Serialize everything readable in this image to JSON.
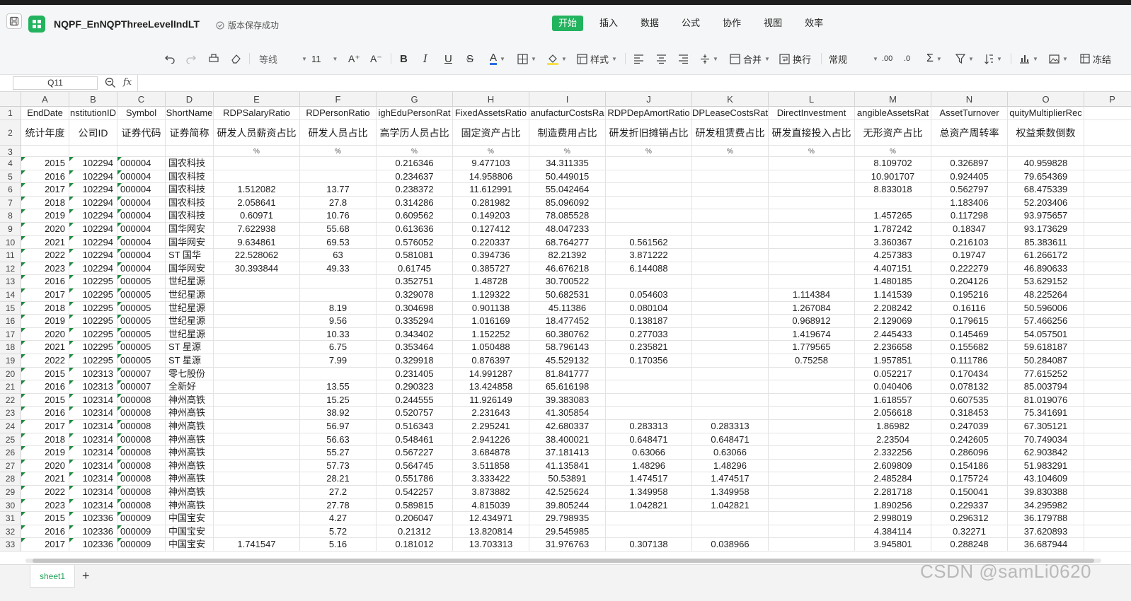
{
  "title_bar": {
    "doc_title": "NQPF_EnNQPThreeLevelIndLT",
    "save_status": "版本保存成功",
    "menu": [
      "开始",
      "插入",
      "数据",
      "公式",
      "协作",
      "视图",
      "效率"
    ],
    "active_menu": "开始",
    "accent_color": "#22b35e"
  },
  "toolbar": {
    "font_name": "等线",
    "font_size": "11",
    "style_label": "样式",
    "merge_label": "合并",
    "wrap_label": "换行",
    "number_format": "常规",
    "freeze_label": "冻结"
  },
  "formula_bar": {
    "cell_ref": "Q11",
    "fx": "fx",
    "value": ""
  },
  "sheet": {
    "col_letters": [
      "A",
      "B",
      "C",
      "D",
      "E",
      "F",
      "G",
      "H",
      "I",
      "J",
      "K",
      "L",
      "M",
      "N",
      "O",
      "P"
    ],
    "header_en": [
      "EndDate",
      "nstitutionID",
      "Symbol",
      "ShortName",
      "RDPSalaryRatio",
      "RDPersonRatio",
      "ighEduPersonRat",
      "FixedAssetsRatio",
      "anufacturCostsRa",
      "RDPDepAmortRatio",
      "DPLeaseCostsRat",
      "DirectInvestment",
      "angibleAssetsRat",
      "AssetTurnover",
      "quityMultiplierRec"
    ],
    "header_cn": [
      "统计年度",
      "公司ID",
      "证券代码",
      "证券简称",
      "研发人员薪资占比",
      "研发人员占比",
      "高学历人员占比",
      "固定资产占比",
      "制造费用占比",
      "研发折旧摊销占比",
      "研发租赁费占比",
      "研发直接投入占比",
      "无形资产占比",
      "总资产周转率",
      "权益乘数倒数"
    ],
    "units": [
      "",
      "",
      "",
      "",
      "%",
      "%",
      "%",
      "%",
      "%",
      "%",
      "%",
      "%",
      "%",
      "",
      ""
    ],
    "rows": [
      [
        "2015",
        "102294",
        "000004",
        "国农科技",
        "",
        "",
        "0.216346",
        "9.477103",
        "34.311335",
        "",
        "",
        "",
        "8.109702",
        "0.326897",
        "40.959828"
      ],
      [
        "2016",
        "102294",
        "000004",
        "国农科技",
        "",
        "",
        "0.234637",
        "14.958806",
        "50.449015",
        "",
        "",
        "",
        "10.901707",
        "0.924405",
        "79.654369"
      ],
      [
        "2017",
        "102294",
        "000004",
        "国农科技",
        "1.512082",
        "13.77",
        "0.238372",
        "11.612991",
        "55.042464",
        "",
        "",
        "",
        "8.833018",
        "0.562797",
        "68.475339"
      ],
      [
        "2018",
        "102294",
        "000004",
        "国农科技",
        "2.058641",
        "27.8",
        "0.314286",
        "0.281982",
        "85.096092",
        "",
        "",
        "",
        "",
        "1.183406",
        "52.203406"
      ],
      [
        "2019",
        "102294",
        "000004",
        "国农科技",
        "0.60971",
        "10.76",
        "0.609562",
        "0.149203",
        "78.085528",
        "",
        "",
        "",
        "1.457265",
        "0.117298",
        "93.975657"
      ],
      [
        "2020",
        "102294",
        "000004",
        "国华网安",
        "7.622938",
        "55.68",
        "0.613636",
        "0.127412",
        "48.047233",
        "",
        "",
        "",
        "1.787242",
        "0.18347",
        "93.173629"
      ],
      [
        "2021",
        "102294",
        "000004",
        "国华网安",
        "9.634861",
        "69.53",
        "0.576052",
        "0.220337",
        "68.764277",
        "0.561562",
        "",
        "",
        "3.360367",
        "0.216103",
        "85.383611"
      ],
      [
        "2022",
        "102294",
        "000004",
        "ST 国华",
        "22.528062",
        "63",
        "0.581081",
        "0.394736",
        "82.21392",
        "3.871222",
        "",
        "",
        "4.257383",
        "0.19747",
        "61.266172"
      ],
      [
        "2023",
        "102294",
        "000004",
        "国华网安",
        "30.393844",
        "49.33",
        "0.61745",
        "0.385727",
        "46.676218",
        "6.144088",
        "",
        "",
        "4.407151",
        "0.222279",
        "46.890633"
      ],
      [
        "2016",
        "102295",
        "000005",
        "世纪星源",
        "",
        "",
        "0.352751",
        "1.48728",
        "30.700522",
        "",
        "",
        "",
        "1.480185",
        "0.204126",
        "53.629152"
      ],
      [
        "2017",
        "102295",
        "000005",
        "世纪星源",
        "",
        "",
        "0.329078",
        "1.129322",
        "50.682531",
        "0.054603",
        "",
        "1.114384",
        "1.141539",
        "0.195216",
        "48.225264"
      ],
      [
        "2018",
        "102295",
        "000005",
        "世纪星源",
        "",
        "8.19",
        "0.304698",
        "0.901138",
        "45.11386",
        "0.080104",
        "",
        "1.267084",
        "2.208242",
        "0.16116",
        "50.596006"
      ],
      [
        "2019",
        "102295",
        "000005",
        "世纪星源",
        "",
        "9.56",
        "0.335294",
        "1.016169",
        "18.477452",
        "0.138187",
        "",
        "0.968912",
        "2.129069",
        "0.179615",
        "57.466256"
      ],
      [
        "2020",
        "102295",
        "000005",
        "世纪星源",
        "",
        "10.33",
        "0.343402",
        "1.152252",
        "60.380762",
        "0.277033",
        "",
        "1.419674",
        "2.445433",
        "0.145469",
        "54.057501"
      ],
      [
        "2021",
        "102295",
        "000005",
        "ST 星源",
        "",
        "6.75",
        "0.353464",
        "1.050488",
        "58.796143",
        "0.235821",
        "",
        "1.779565",
        "2.236658",
        "0.155682",
        "59.618187"
      ],
      [
        "2022",
        "102295",
        "000005",
        "ST 星源",
        "",
        "7.99",
        "0.329918",
        "0.876397",
        "45.529132",
        "0.170356",
        "",
        "0.75258",
        "1.957851",
        "0.111786",
        "50.284087"
      ],
      [
        "2015",
        "102313",
        "000007",
        "零七股份",
        "",
        "",
        "0.231405",
        "14.991287",
        "81.841777",
        "",
        "",
        "",
        "0.052217",
        "0.170434",
        "77.615252"
      ],
      [
        "2016",
        "102313",
        "000007",
        "全新好",
        "",
        "13.55",
        "0.290323",
        "13.424858",
        "65.616198",
        "",
        "",
        "",
        "0.040406",
        "0.078132",
        "85.003794"
      ],
      [
        "2015",
        "102314",
        "000008",
        "神州高铁",
        "",
        "15.25",
        "0.244555",
        "11.926149",
        "39.383083",
        "",
        "",
        "",
        "1.618557",
        "0.607535",
        "81.019076"
      ],
      [
        "2016",
        "102314",
        "000008",
        "神州高铁",
        "",
        "38.92",
        "0.520757",
        "2.231643",
        "41.305854",
        "",
        "",
        "",
        "2.056618",
        "0.318453",
        "75.341691"
      ],
      [
        "2017",
        "102314",
        "000008",
        "神州高铁",
        "",
        "56.97",
        "0.516343",
        "2.295241",
        "42.680337",
        "0.283313",
        "0.283313",
        "",
        "1.86982",
        "0.247039",
        "67.305121"
      ],
      [
        "2018",
        "102314",
        "000008",
        "神州高铁",
        "",
        "56.63",
        "0.548461",
        "2.941226",
        "38.400021",
        "0.648471",
        "0.648471",
        "",
        "2.23504",
        "0.242605",
        "70.749034"
      ],
      [
        "2019",
        "102314",
        "000008",
        "神州高铁",
        "",
        "55.27",
        "0.567227",
        "3.684878",
        "37.181413",
        "0.63066",
        "0.63066",
        "",
        "2.332256",
        "0.286096",
        "62.903842"
      ],
      [
        "2020",
        "102314",
        "000008",
        "神州高铁",
        "",
        "57.73",
        "0.564745",
        "3.511858",
        "41.135841",
        "1.48296",
        "1.48296",
        "",
        "2.609809",
        "0.154186",
        "51.983291"
      ],
      [
        "2021",
        "102314",
        "000008",
        "神州高铁",
        "",
        "28.21",
        "0.551786",
        "3.333422",
        "50.53891",
        "1.474517",
        "1.474517",
        "",
        "2.485284",
        "0.175724",
        "43.104609"
      ],
      [
        "2022",
        "102314",
        "000008",
        "神州高铁",
        "",
        "27.2",
        "0.542257",
        "3.873882",
        "42.525624",
        "1.349958",
        "1.349958",
        "",
        "2.281718",
        "0.150041",
        "39.830388"
      ],
      [
        "2023",
        "102314",
        "000008",
        "神州高铁",
        "",
        "27.78",
        "0.589815",
        "4.815039",
        "39.805244",
        "1.042821",
        "1.042821",
        "",
        "1.890256",
        "0.229337",
        "34.295982"
      ],
      [
        "2015",
        "102336",
        "000009",
        "中国宝安",
        "",
        "4.27",
        "0.206047",
        "12.434971",
        "29.798935",
        "",
        "",
        "",
        "2.998019",
        "0.296312",
        "36.179788"
      ],
      [
        "2016",
        "102336",
        "000009",
        "中国宝安",
        "",
        "5.72",
        "0.21312",
        "13.820814",
        "29.545985",
        "",
        "",
        "",
        "4.384114",
        "0.32271",
        "37.620893"
      ],
      [
        "2017",
        "102336",
        "000009",
        "中国宝安",
        "1.741547",
        "5.16",
        "0.181012",
        "13.703313",
        "31.976763",
        "0.307138",
        "0.038966",
        "",
        "3.945801",
        "0.288248",
        "36.687944"
      ]
    ]
  },
  "sheet_tabs": [
    "sheet1"
  ],
  "watermark": "CSDN @samLi0620"
}
